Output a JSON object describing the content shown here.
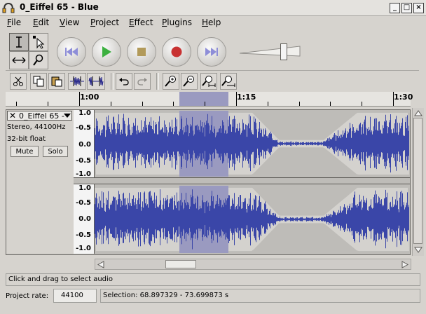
{
  "window": {
    "title": "0_Eiffel 65 - Blue",
    "buttons": [
      "_",
      "□",
      "×"
    ]
  },
  "menus": [
    {
      "label": "File",
      "ul": "F",
      "rest": "ile"
    },
    {
      "label": "Edit",
      "ul": "E",
      "rest": "dit"
    },
    {
      "label": "View",
      "ul": "V",
      "rest": "iew"
    },
    {
      "label": "Project",
      "ul": "P",
      "rest": "roject"
    },
    {
      "label": "Effect",
      "ul": "E",
      "rest": "ffect"
    },
    {
      "label": "Plugins",
      "ul": "P",
      "rest": "lugins"
    },
    {
      "label": "Help",
      "ul": "H",
      "rest": "elp"
    }
  ],
  "tools": [
    "selection-tool",
    "envelope-tool",
    "time-shift-tool",
    "zoom-tool"
  ],
  "transport": [
    "skip-to-start",
    "play",
    "stop",
    "record",
    "skip-to-end"
  ],
  "volume_level": 0.72,
  "edit_tools": [
    "cut",
    "copy",
    "paste",
    "trim",
    "silence",
    "undo",
    "redo",
    "zoom-in",
    "zoom-out",
    "fit-selection",
    "fit-project"
  ],
  "ruler": {
    "labels": [
      "1:00",
      "1:15",
      "1:30"
    ]
  },
  "track": {
    "name": "0_Eiffel 65 -",
    "info_line1": "Stereo, 44100Hz",
    "info_line2": "32-bit float",
    "mute_label": "Mute",
    "solo_label": "Solo",
    "scale_labels": [
      "1.0",
      "-0.5",
      "0.0",
      "-0.5",
      "-1.0"
    ],
    "selection_color": "#9a9ac0",
    "wave_color": "#3a46a8"
  },
  "status": {
    "hint": "Click and drag to select audio",
    "rate_label": "Project rate:",
    "rate_value": "44100",
    "selection": "Selection: 68.897329 - 73.699873 s"
  }
}
